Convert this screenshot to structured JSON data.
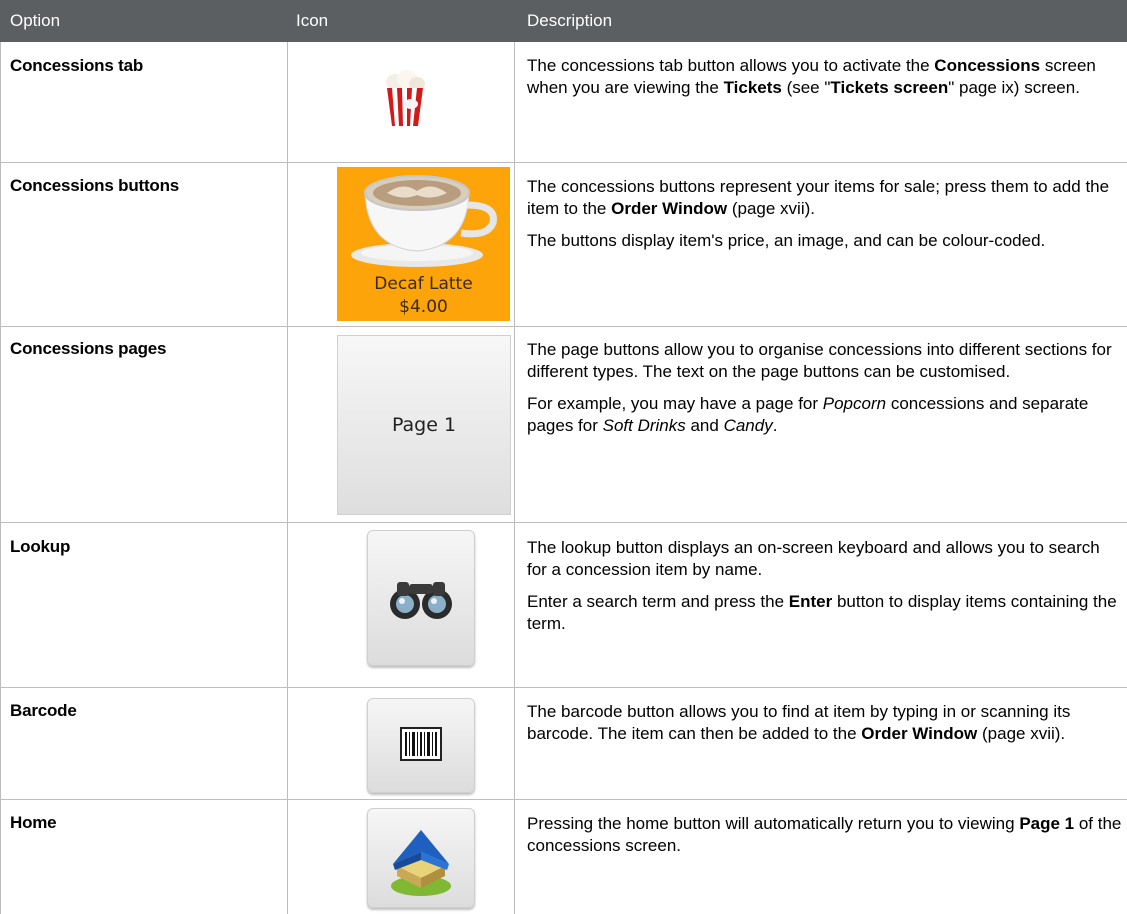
{
  "header": {
    "option": "Option",
    "icon": "Icon",
    "description": "Description"
  },
  "rows": [
    {
      "option": "Concessions tab",
      "icon": "popcorn-icon",
      "p1": [
        "The concessions tab button allows you to activate the ",
        "Concessions",
        " screen when you are viewing the ",
        "Tickets",
        " (see \"",
        "Tickets screen",
        "\" page ix) screen."
      ]
    },
    {
      "option": "Concessions buttons",
      "icon": "decaf-latte-button",
      "icon_label_1": "Decaf Latte",
      "icon_label_2": "$4.00",
      "p1": [
        "The concessions buttons represent your items for sale; press them to add the item to the ",
        "Order Window",
        " (page xvii)."
      ],
      "p2": "The buttons display item's price, an image, and can be colour-coded."
    },
    {
      "option": "Concessions pages",
      "icon": "page-button",
      "icon_label": "Page 1",
      "p1": "The page buttons allow you to organise concessions into different sections for different types. The text on the page buttons can be customised.",
      "p2": [
        "For example, you may have a page for ",
        "Popcorn",
        " concessions and separate pages for ",
        "Soft Drinks",
        " and ",
        "Candy",
        "."
      ]
    },
    {
      "option": "Lookup",
      "icon": "binoculars-icon",
      "p1": "The lookup button displays an on-screen keyboard and allows you to search for a concession item by name.",
      "p2": [
        "Enter a search term and press the ",
        "Enter",
        " button to display items containing the term."
      ]
    },
    {
      "option": "Barcode",
      "icon": "barcode-icon",
      "p1": [
        "The barcode button allows you to find at item by typing in or scanning its barcode. The item can then be added to the ",
        "Order Window",
        " (page xvii)."
      ]
    },
    {
      "option": "Home",
      "icon": "home-icon",
      "p1": [
        "Pressing the home button will automatically return you to viewing ",
        "Page 1",
        " of the concessions screen."
      ]
    }
  ],
  "colors": {
    "header_bg": "#5b5f62",
    "latte_bg": "#fca40a",
    "grid": "#bdbdbd"
  }
}
